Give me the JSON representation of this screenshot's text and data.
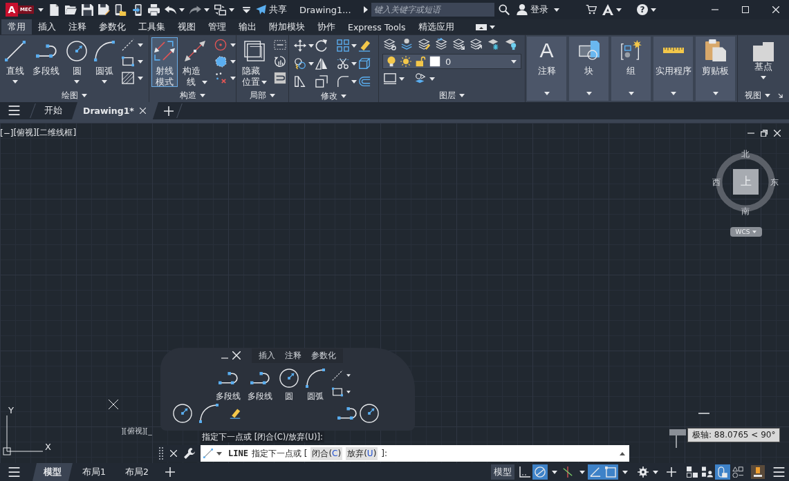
{
  "title_bar": {
    "logo": {
      "letter": "A",
      "badge": "MEC"
    },
    "share": "共享",
    "document": "Drawing1...",
    "search": {
      "placeholder": "键入关键字或短语"
    },
    "sign_in": "登录",
    "help": "?"
  },
  "ribbon": {
    "tabs": [
      {
        "label": "常用",
        "selected": true
      },
      {
        "label": "插入",
        "selected": false
      },
      {
        "label": "注释",
        "selected": false
      },
      {
        "label": "参数化",
        "selected": false
      },
      {
        "label": "工具集",
        "selected": false
      },
      {
        "label": "视图",
        "selected": false
      },
      {
        "label": "管理",
        "selected": false
      },
      {
        "label": "输出",
        "selected": false
      },
      {
        "label": "附加模块",
        "selected": false
      },
      {
        "label": "协作",
        "selected": false
      },
      {
        "label": "Express Tools",
        "selected": false
      },
      {
        "label": "精选应用",
        "selected": false
      }
    ],
    "panels": [
      {
        "title": "绘图",
        "kind": "tools",
        "tools": [
          {
            "label": "直线",
            "kind": "short",
            "dropdown": true,
            "active": false
          },
          {
            "label": "多段线",
            "kind": "short",
            "dropdown": false,
            "active": false
          },
          {
            "label": "圆",
            "kind": "short",
            "dropdown": true,
            "active": false
          },
          {
            "label": "圆弧",
            "kind": "short",
            "dropdown": true,
            "active": false
          }
        ]
      },
      {
        "title": "构造",
        "kind": "tools",
        "tools": [
          {
            "label": "射线模式",
            "kind": "wrapped",
            "dropdown": false,
            "active": true
          },
          {
            "label": "构造线",
            "kind": "wrapped",
            "dropdown": true,
            "active": false
          }
        ]
      },
      {
        "title": "局部",
        "kind": "tools",
        "tools": [
          {
            "label": "隐藏位置",
            "kind": "wrapped",
            "dropdown": true,
            "active": false
          }
        ]
      },
      {
        "title": "修改",
        "kind": "icon_grid"
      },
      {
        "title": "图层",
        "kind": "layers",
        "layer": "0"
      }
    ],
    "tall_buttons": [
      {
        "label": "注释",
        "glyph": "A"
      },
      {
        "label": "块"
      },
      {
        "label": "组"
      },
      {
        "label": "实用程序"
      },
      {
        "label": "剪贴板"
      }
    ],
    "view_panel": {
      "tool": "基点",
      "title": "视图"
    }
  },
  "file_tabs": [
    {
      "label": "开始",
      "selected": false
    },
    {
      "label": "Drawing1*",
      "selected": true
    }
  ],
  "viewport": {
    "controls": [
      "[−]",
      "[俯视]",
      "[二维线框]"
    ],
    "viewcube": {
      "north": "北",
      "south": "南",
      "east": "东",
      "west": "西",
      "face": "上",
      "ucs": "WCS"
    },
    "ucs_icon": {
      "x_label": "X",
      "y_label": "Y"
    },
    "ghost": {
      "tabs": [
        "插入",
        "注释",
        "参数化"
      ],
      "tools": [
        "多段线",
        "多段线",
        "圆",
        "圆弧"
      ],
      "view_label": "][俯视][_",
      "prompt": "指定下一点或 [闭合(C)/放弃(U)]:"
    },
    "tooltip": "极轴: 88.0765 < 90°"
  },
  "command_line": {
    "command": "LINE",
    "prompt": "指定下一点或 [",
    "options": [
      {
        "open": "闭合(",
        "key": "C",
        "close": ")"
      },
      {
        "open": "放弃(",
        "key": "U",
        "close": ")"
      }
    ],
    "end": "]:"
  },
  "status_bar": {
    "layouts": [
      {
        "label": "模型",
        "selected": true
      },
      {
        "label": "布局1",
        "selected": false
      },
      {
        "label": "布局2",
        "selected": false
      }
    ],
    "space": "模型",
    "toggles": [
      {
        "on": false
      },
      {
        "on": true
      },
      {
        "on": false
      },
      {
        "on": true
      },
      {
        "on": true
      },
      {
        "on": false
      },
      {
        "on": false
      },
      {
        "on": true
      },
      {
        "on": false
      }
    ]
  }
}
